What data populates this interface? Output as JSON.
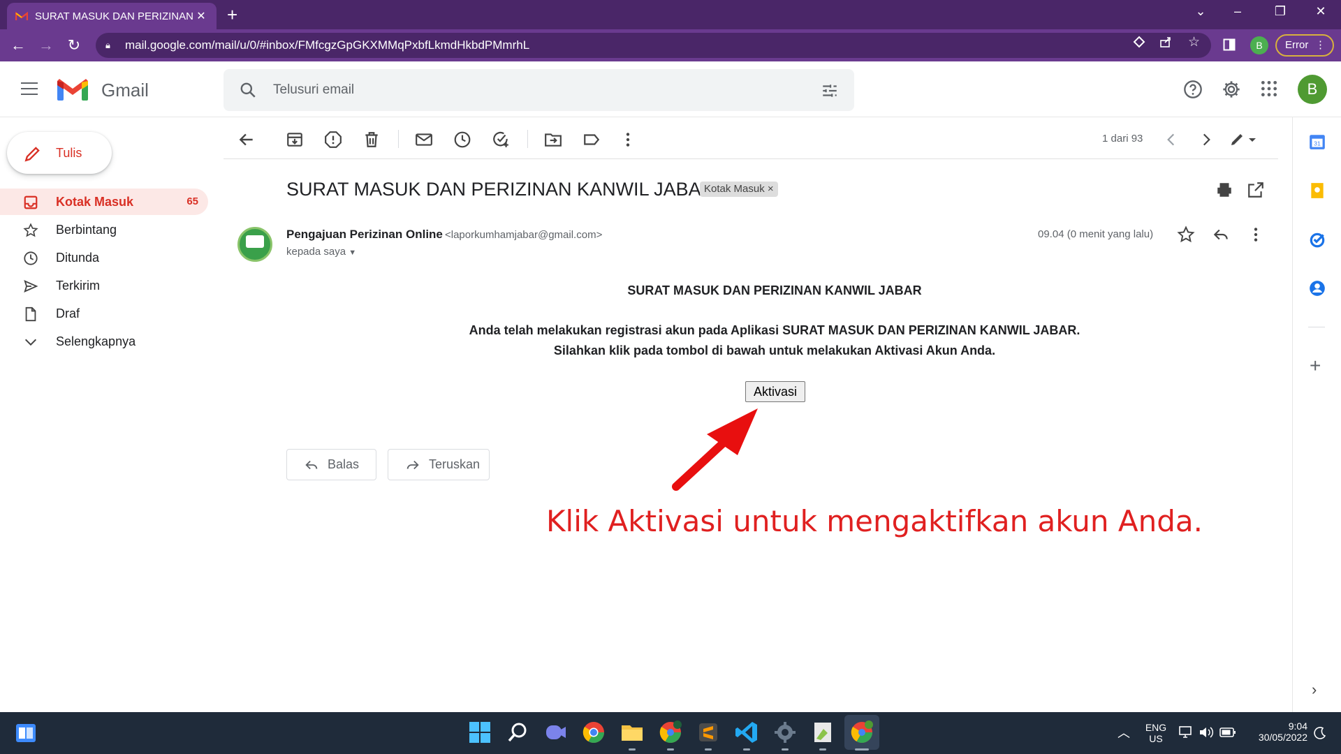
{
  "browser": {
    "tab_title": "SURAT MASUK DAN PERIZINAN I",
    "url": "mail.google.com/mail/u/0/#inbox/FMfcgzGpGKXMMqPxbfLkmdHkbdPMmrhL",
    "profile_initial": "B",
    "error_label": "Error"
  },
  "gmail": {
    "app_name": "Gmail",
    "search_placeholder": "Telusuri email",
    "avatar_initial": "B"
  },
  "sidebar": {
    "compose_label": "Tulis",
    "items": [
      {
        "label": "Kotak Masuk",
        "count": "65",
        "icon": "inbox-icon"
      },
      {
        "label": "Berbintang",
        "icon": "star-icon"
      },
      {
        "label": "Ditunda",
        "icon": "clock-icon"
      },
      {
        "label": "Terkirim",
        "icon": "send-icon"
      },
      {
        "label": "Draf",
        "icon": "draft-icon"
      },
      {
        "label": "Selengkapnya",
        "icon": "chevron-down-icon"
      }
    ]
  },
  "toolbar": {
    "pager": "1 dari 93"
  },
  "message": {
    "subject": "SURAT MASUK DAN PERIZINAN KANWIL JABAR",
    "label_chip": "Kotak Masuk",
    "sender_name": "Pengajuan Perizinan Online",
    "sender_email": "<laporkumhamjabar@gmail.com>",
    "to": "kepada saya",
    "time": "09.04 (0 menit yang lalu)",
    "body_title": "SURAT MASUK DAN PERIZINAN KANWIL JABAR",
    "body_line1": "Anda telah melakukan registrasi akun pada Aplikasi SURAT MASUK DAN PERIZINAN KANWIL JABAR.",
    "body_line2": "Silahkan klik pada tombol di bawah untuk melakukan Aktivasi Akun Anda.",
    "activate_label": "Aktivasi",
    "reply_label": "Balas",
    "forward_label": "Teruskan"
  },
  "annotation": {
    "text": "Klik Aktivasi untuk mengaktifkan akun Anda.",
    "color": "#e02020"
  },
  "taskbar": {
    "lang_line1": "ENG",
    "lang_line2": "US",
    "time": "9:04",
    "date": "30/05/2022"
  },
  "colors": {
    "browser_frame": "#4a2668",
    "gmail_red": "#d93025",
    "active_nav_bg": "#fce8e6"
  }
}
